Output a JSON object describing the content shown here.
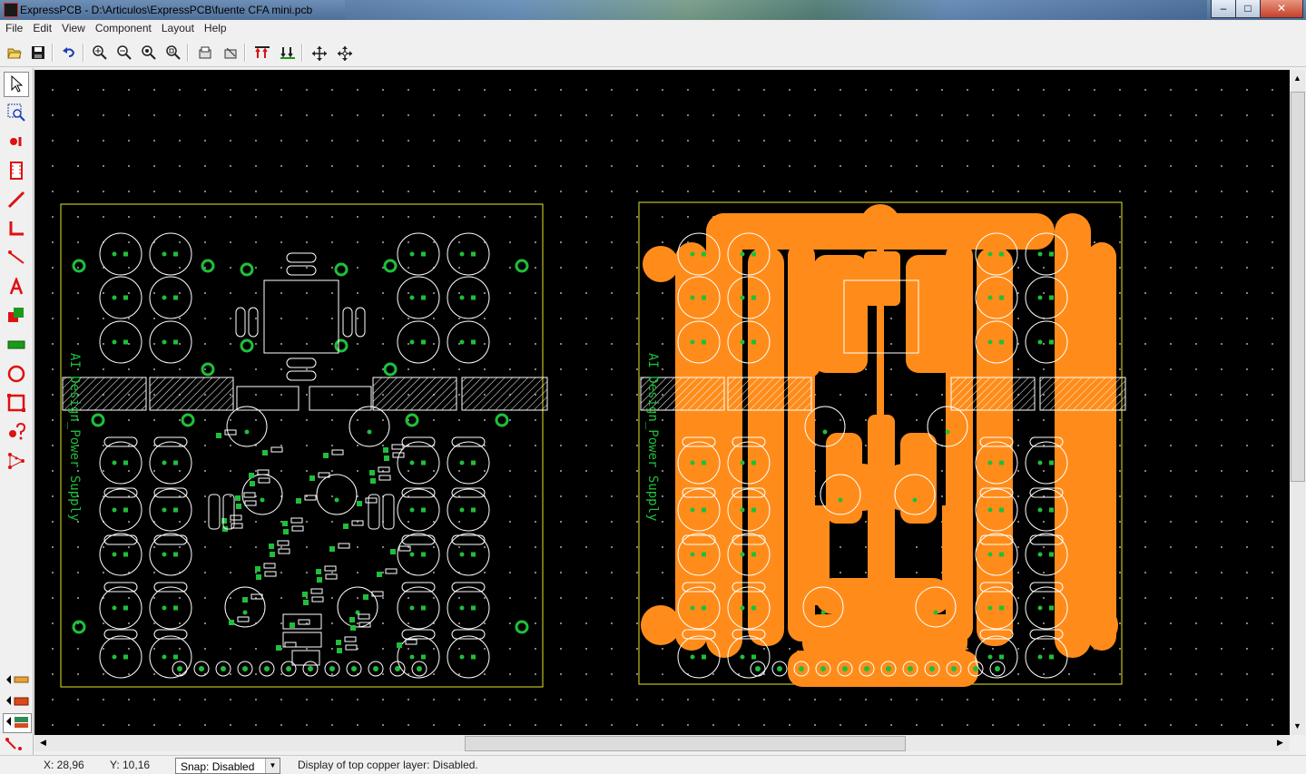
{
  "window": {
    "title": "ExpressPCB - D:\\Articulos\\ExpressPCB\\fuente CFA mini.pcb",
    "minimize": "–",
    "restore": "□",
    "close": "✕"
  },
  "menu": [
    "File",
    "Edit",
    "View",
    "Component",
    "Layout",
    "Help"
  ],
  "toolbar": [
    {
      "name": "open-icon"
    },
    {
      "name": "save-icon"
    },
    {
      "name": "undo-icon"
    },
    {
      "name": "zoom-in-icon"
    },
    {
      "name": "zoom-out-icon"
    },
    {
      "name": "zoom-fit-icon"
    },
    {
      "name": "zoom-window-icon"
    },
    {
      "name": "properties-icon"
    },
    {
      "name": "component-properties-icon"
    },
    {
      "name": "top-layer-icon"
    },
    {
      "name": "bottom-layer-icon"
    },
    {
      "name": "move-icon"
    },
    {
      "name": "align-icon"
    }
  ],
  "tools": [
    {
      "name": "select-arrow-icon",
      "selected": true
    },
    {
      "name": "zoom-select-icon"
    },
    {
      "name": "place-pad-icon"
    },
    {
      "name": "place-component-icon"
    },
    {
      "name": "place-trace-icon"
    },
    {
      "name": "place-angle-trace-icon"
    },
    {
      "name": "place-wire-icon"
    },
    {
      "name": "place-text-icon"
    },
    {
      "name": "place-filled-shape-icon"
    },
    {
      "name": "place-filled-polygon-icon"
    },
    {
      "name": "place-circle-icon"
    },
    {
      "name": "place-rectangle-icon"
    },
    {
      "name": "component-info-icon"
    },
    {
      "name": "netlist-icon"
    }
  ],
  "layers": [
    {
      "name": "top-copper-layer-icon",
      "color": "#d94a1a"
    },
    {
      "name": "bottom-copper-layer-icon",
      "color": "#d94a1a"
    },
    {
      "name": "both-layers-icon",
      "color": "#2e8b57",
      "selected": true
    },
    {
      "name": "silkscreen-layer-icon",
      "color": "#d94a1a"
    }
  ],
  "colors": {
    "canvas": "#000000",
    "silkscreen": "#ffffff",
    "pads": "#1fbf3a",
    "outline": "#e6e62a",
    "copper": "#ff8c1a"
  },
  "board_left": {
    "silk_text": "AI Design_Power Supply"
  },
  "board_right": {
    "silk_text": "AI Design_Power Supply"
  },
  "status": {
    "x": "X: 28,96",
    "y": "Y: 10,16",
    "snap_label": "Snap:",
    "snap_value": "Disabled",
    "message": "Display of top copper layer:  Disabled."
  }
}
